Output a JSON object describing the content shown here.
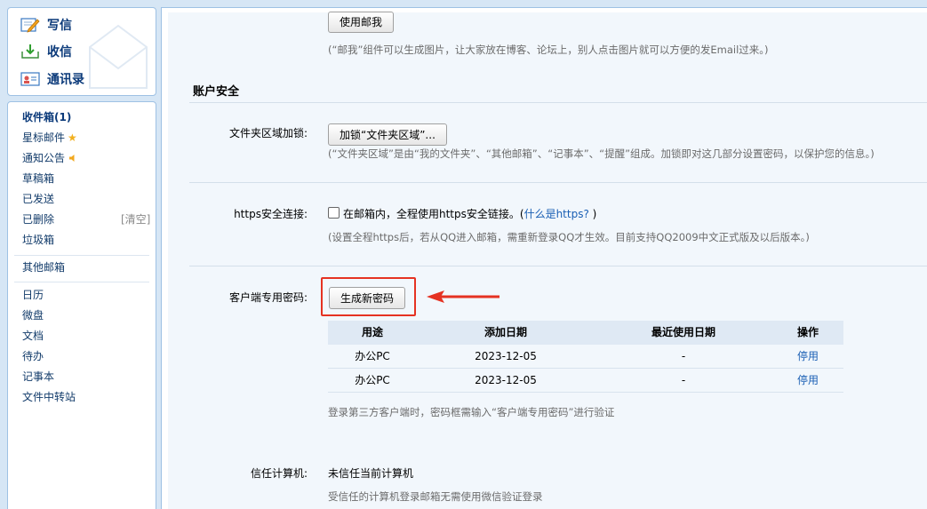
{
  "sidebar": {
    "compose": [
      {
        "label": "写信",
        "icon": "compose-icon"
      },
      {
        "label": "收信",
        "icon": "inbox-download-icon"
      },
      {
        "label": "通讯录",
        "icon": "contacts-card-icon"
      }
    ],
    "folders": {
      "inbox": "收件箱(1)",
      "starred": "星标邮件",
      "notices": "通知公告",
      "drafts": "草稿箱",
      "sent": "已发送",
      "deleted": "已删除",
      "deleted_clean": "[清空]",
      "spam": "垃圾箱",
      "other_mailboxes": "其他邮箱",
      "calendar": "日历",
      "weiyun": "微盘",
      "docs": "文档",
      "todo": "待办",
      "notes": "记事本",
      "file_transfer": "文件中转站"
    }
  },
  "main": {
    "use_mailme_button": "使用邮我",
    "mailme_hint": "(“邮我”组件可以生成图片，让大家放在博客、论坛上，别人点击图片就可以方便的发Email过来。)",
    "section_title": "账户安全",
    "folder_lock": {
      "label": "文件夹区域加锁:",
      "button": "加锁“文件夹区域”...",
      "hint": "(“文件夹区域”是由“我的文件夹”、“其他邮箱”、“记事本”、“提醒”组成。加锁即对这几部分设置密码，以保护您的信息。)"
    },
    "https": {
      "label": "https安全连接:",
      "checkbox_text": "在邮箱内，全程使用https安全链接。(",
      "link": "什么是https?",
      "close_paren": " )",
      "checked": false,
      "hint": "(设置全程https后，若从QQ进入邮箱，需重新登录QQ才生效。目前支持QQ2009中文正式版及以后版本。)"
    },
    "client_password": {
      "label": "客户端专用密码:",
      "button": "生成新密码",
      "table": {
        "headers": [
          "用途",
          "添加日期",
          "最近使用日期",
          "操作"
        ],
        "rows": [
          {
            "purpose": "办公PC",
            "added": "2023-12-05",
            "last_used": "-",
            "action": "停用"
          },
          {
            "purpose": "办公PC",
            "added": "2023-12-05",
            "last_used": "-",
            "action": "停用"
          }
        ]
      },
      "hint": "登录第三方客户端时，密码框需输入“客户端专用密码”进行验证"
    },
    "trusted_pc": {
      "label": "信任计算机:",
      "status": "未信任当前计算机",
      "hint": "受信任的计算机登录邮箱无需使用微信验证登录"
    }
  },
  "colors": {
    "highlight": "#e53222",
    "link": "#1a5fb4",
    "sidebar_text": "#0b3a7a"
  }
}
